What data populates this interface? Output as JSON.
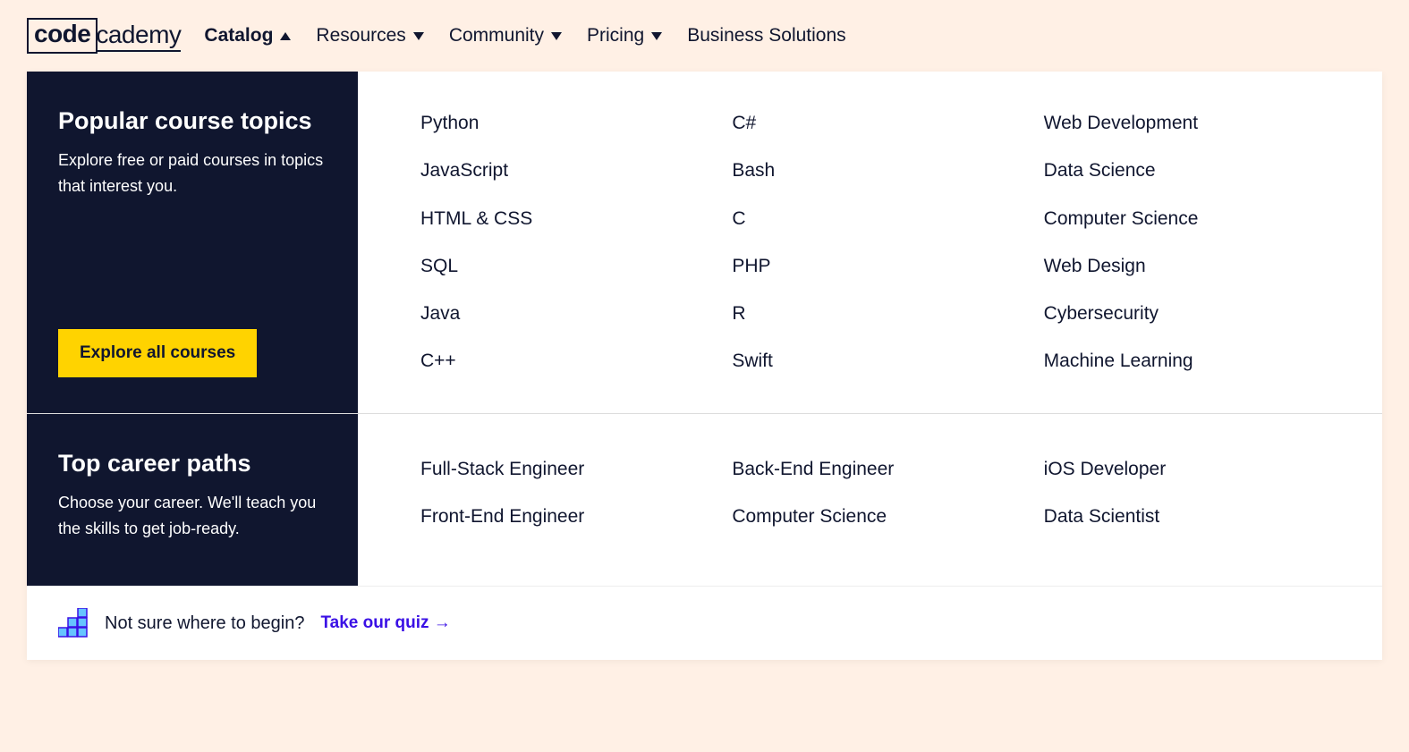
{
  "logo": {
    "boxed": "code",
    "rest": "cademy"
  },
  "nav": {
    "items": [
      {
        "label": "Catalog",
        "arrow": "up",
        "active": true
      },
      {
        "label": "Resources",
        "arrow": "down",
        "active": false
      },
      {
        "label": "Community",
        "arrow": "down",
        "active": false
      },
      {
        "label": "Pricing",
        "arrow": "down",
        "active": false
      },
      {
        "label": "Business Solutions",
        "arrow": null,
        "active": false
      }
    ]
  },
  "popular": {
    "title": "Popular course topics",
    "desc": "Explore free or paid courses in topics that interest you.",
    "button": "Explore all courses",
    "topics": [
      "Python",
      "C#",
      "Web Development",
      "JavaScript",
      "Bash",
      "Data Science",
      "HTML & CSS",
      "C",
      "Computer Science",
      "SQL",
      "PHP",
      "Web Design",
      "Java",
      "R",
      "Cybersecurity",
      "C++",
      "Swift",
      "Machine Learning"
    ]
  },
  "careers": {
    "title": "Top career paths",
    "desc": "Choose your career. We'll teach you the skills to get job-ready.",
    "paths": [
      "Full-Stack Engineer",
      "Back-End Engineer",
      "iOS Developer",
      "Front-End Engineer",
      "Computer Science",
      "Data Scientist"
    ]
  },
  "quiz": {
    "text": "Not sure where to begin?",
    "link": "Take our quiz →"
  }
}
